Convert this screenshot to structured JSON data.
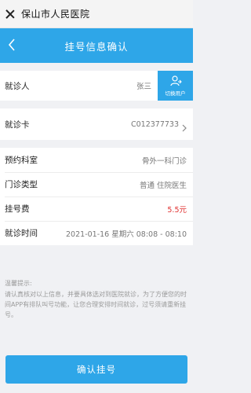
{
  "wechat_bar": {
    "title": "保山市人民医院"
  },
  "nav": {
    "title": "挂号信息确认"
  },
  "patient": {
    "label": "就诊人",
    "name": "张三",
    "switch_label": "切换用户"
  },
  "card": {
    "label": "就诊卡",
    "number": "C012377733"
  },
  "details": {
    "dept_label": "预约科室",
    "dept_value": "骨外一科门诊",
    "type_label": "门诊类型",
    "type_value": "普通  住院医生",
    "fee_label": "挂号费",
    "fee_value": "5.5元",
    "time_label": "就诊时间",
    "time_value": "2021-01-16  星期六  08:08 - 08:10"
  },
  "tips": {
    "title": "温馨提示:",
    "text": "请认真核对以上信息，并要具体选对到医院就诊，为了方便您的时间APP有排队叫号功能，让您合理安排时间就诊，过号须请重新挂号。"
  },
  "confirm": {
    "label": "确认挂号"
  },
  "colors": {
    "accent": "#2ea6e8",
    "fee": "#e0302f"
  }
}
